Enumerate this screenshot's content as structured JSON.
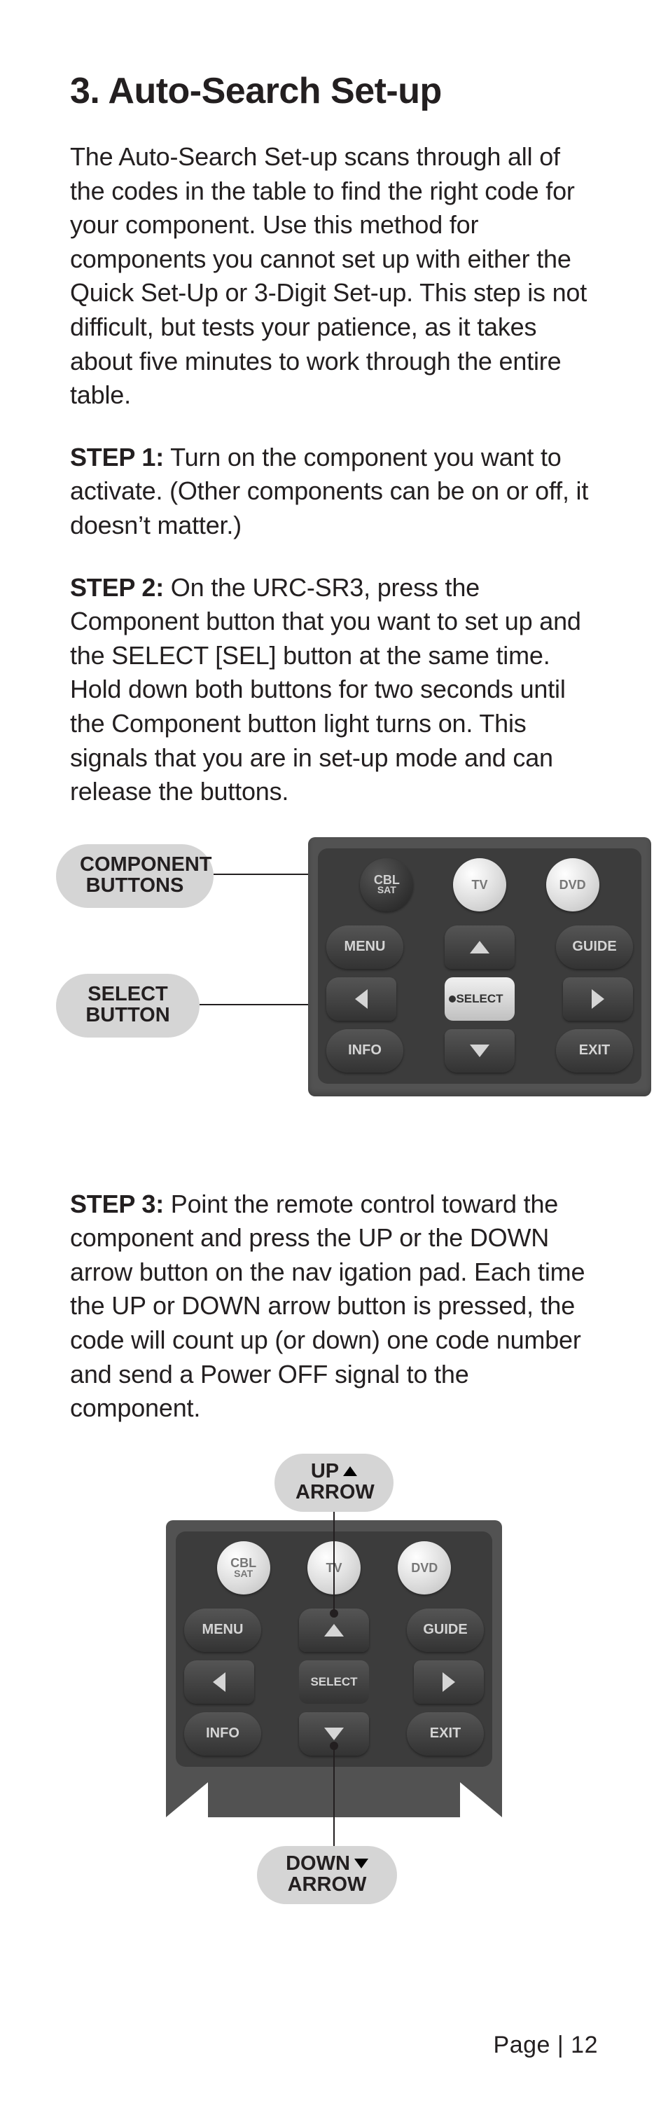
{
  "section": {
    "number": "3.",
    "title": "Auto-Search Set-up"
  },
  "intro": "The Auto-Search Set-up scans through all of the codes in the table to find the right code for your component. Use this method for components you cannot set up with either the Quick Set-Up or 3-Digit Set-up. This step is not difficult, but tests your patience, as it takes about five minutes to work through the entire table.",
  "steps": {
    "s1_label": "STEP 1:",
    "s1_body": " Turn on the component you want to activate. (Other components can be on or off, it doesn’t matter.)",
    "s2_label": "STEP 2:",
    "s2_body": " On the URC-SR3, press the Component button that you want to set up and the SELECT [SEL] button at the same time. Hold down both buttons for two seconds until the Component button light turns on. This signals that you are in set-up mode and can release the buttons.",
    "s3_label": "STEP 3:",
    "s3_body": " Point the remote control toward the component and press the UP or the DOWN arrow button on the nav igation pad. Each time the UP or DOWN arrow button is pressed, the code will count up (or down) one code number and send a Power OFF signal to the component."
  },
  "callouts": {
    "component_l1": "COMPONENT",
    "component_l2": "BUTTONS",
    "select_l1": "SELECT",
    "select_l2": "BUTTON",
    "up_l1": "UP",
    "up_l2": "ARROW",
    "down_l1": "DOWN",
    "down_l2": "ARROW"
  },
  "remote": {
    "cbl_sat_l1": "CBL",
    "cbl_sat_l2": "SAT",
    "tv": "TV",
    "dvd": "DVD",
    "menu": "MENU",
    "guide": "GUIDE",
    "select": "SELECT",
    "info": "INFO",
    "exit": "EXIT"
  },
  "footer": {
    "page_label": "Page | 12"
  }
}
